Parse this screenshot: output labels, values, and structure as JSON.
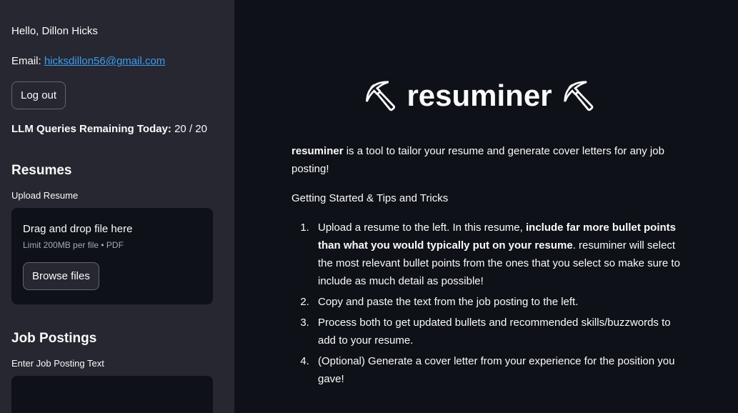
{
  "sidebar": {
    "greeting": "Hello, Dillon Hicks",
    "email_prefix": "Email: ",
    "email": "hicksdillon56@gmail.com",
    "logout_label": "Log out",
    "queries_label": "LLM Queries Remaining Today:",
    "queries_value": " 20 / 20",
    "resumes_header": "Resumes",
    "upload_label": "Upload Resume",
    "dropzone_title": "Drag and drop file here",
    "dropzone_limit": "Limit 200MB per file • PDF",
    "browse_label": "Browse files",
    "job_header": "Job Postings",
    "job_label": "Enter Job Posting Text"
  },
  "main": {
    "title_icon": "⛏",
    "title": "resuminer",
    "intro_bold": "resuminer",
    "intro_rest": " is a tool to tailor your resume and generate cover letters for any job posting!",
    "tips_header": "Getting Started & Tips and Tricks",
    "step1_a": "Upload a resume to the left. In this resume, ",
    "step1_bold": "include far more bullet points than what you would typically put on your resume",
    "step1_b": ". resuminer will select the most relevant bullet points from the ones that you select so make sure to include as much detail as possible!",
    "step2": "Copy and paste the text from the job posting to the left.",
    "step3": "Process both to get updated bullets and recommended skills/buzzwords to add to your resume.",
    "step4": "(Optional) Generate a cover letter from your experience for the position you gave!"
  },
  "colors": {
    "sidebar_bg": "#262730",
    "main_bg": "#0e1117",
    "link": "#3d9df3"
  }
}
